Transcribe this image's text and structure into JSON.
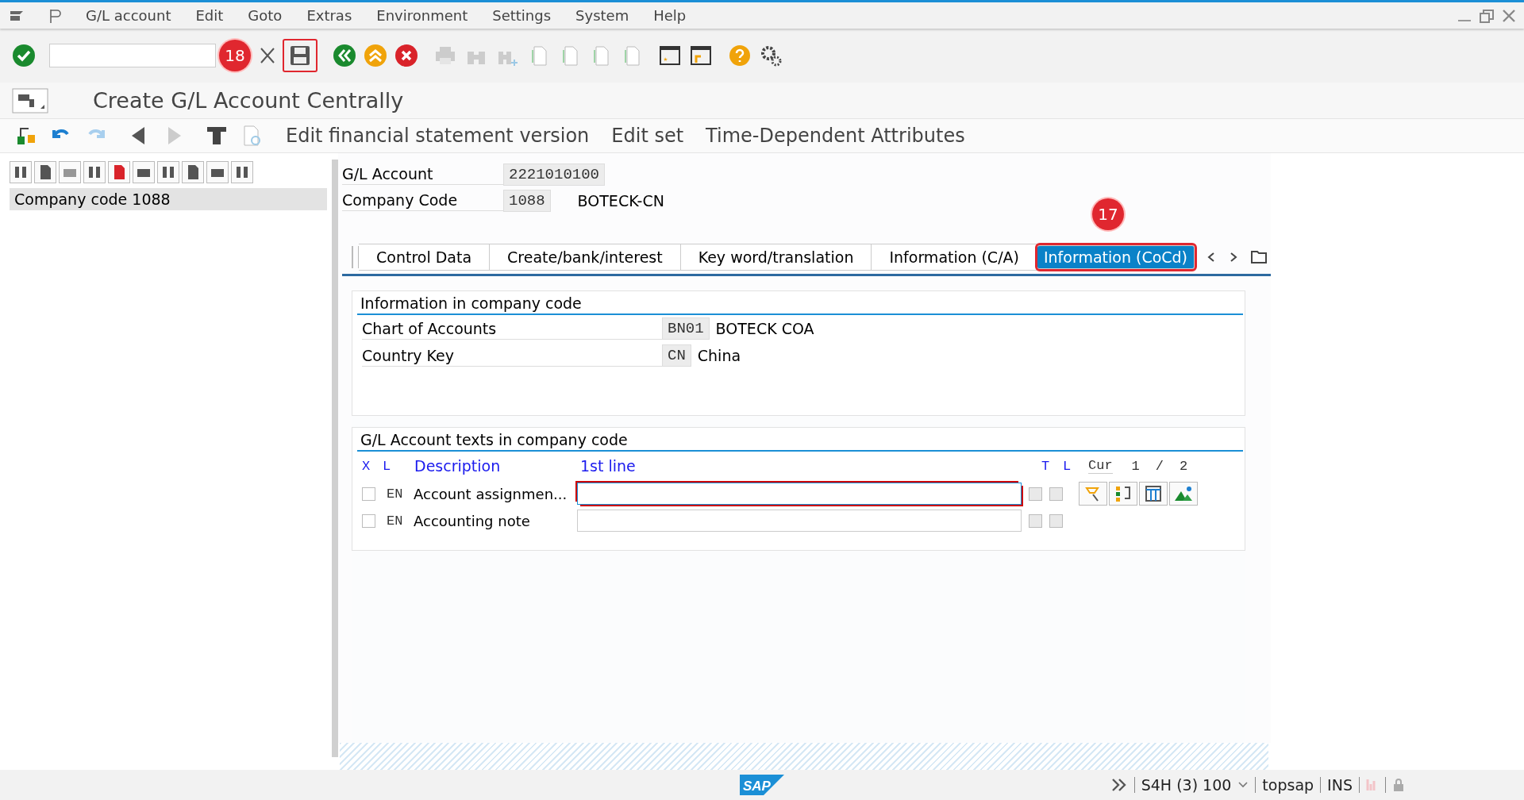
{
  "menu": [
    "G/L account",
    "Edit",
    "Goto",
    "Extras",
    "Environment",
    "Settings",
    "System",
    "Help"
  ],
  "toolbar": {
    "annotation": "18",
    "save_highlighted": true
  },
  "title": "Create G/L Account Centrally",
  "app_toolbar": [
    "Edit financial statement version",
    "Edit set",
    "Time-Dependent Attributes"
  ],
  "tree": [
    {
      "label": "Company code 1088",
      "selected": true
    }
  ],
  "header": [
    {
      "label": "G/L Account",
      "value": "2221010100"
    },
    {
      "label": "Company Code",
      "value": "1088",
      "description": "BOTECK-CN"
    }
  ],
  "tabs": [
    {
      "label": "Control Data",
      "selected": false,
      "highlighted": false
    },
    {
      "label": "Create/bank/interest",
      "selected": false,
      "highlighted": false
    },
    {
      "label": "Key word/translation",
      "selected": false,
      "highlighted": false
    },
    {
      "label": "Information (C/A)",
      "selected": false,
      "highlighted": false
    },
    {
      "label": "Information (CoCd)",
      "selected": true,
      "highlighted": true
    }
  ],
  "tab_annotation": "17",
  "info_group": {
    "title": "Information in company code",
    "rows": [
      {
        "label": "Chart of Accounts",
        "value": "BN01",
        "description": "BOTECK COA"
      },
      {
        "label": "Country Key",
        "value": "CN",
        "description": "China"
      }
    ]
  },
  "texts_group": {
    "title": "G/L Account texts in company code",
    "columns": [
      "X",
      "L",
      "Description",
      "1st line",
      "T",
      "L"
    ],
    "cur_label": "Cur",
    "page": "1",
    "page_sep": "/",
    "page_total": "2",
    "rows": [
      {
        "checked": false,
        "lang": "EN",
        "description": "Account assignmen...",
        "focused": true,
        "t_checked": false,
        "l_checked": false
      },
      {
        "checked": false,
        "lang": "EN",
        "description": "Accounting note",
        "focused": false,
        "t_checked": false,
        "l_checked": false
      }
    ]
  },
  "status_bar": {
    "logo": "SAP",
    "system": "S4H (3) 100",
    "server": "topsap",
    "mode": "INS"
  }
}
